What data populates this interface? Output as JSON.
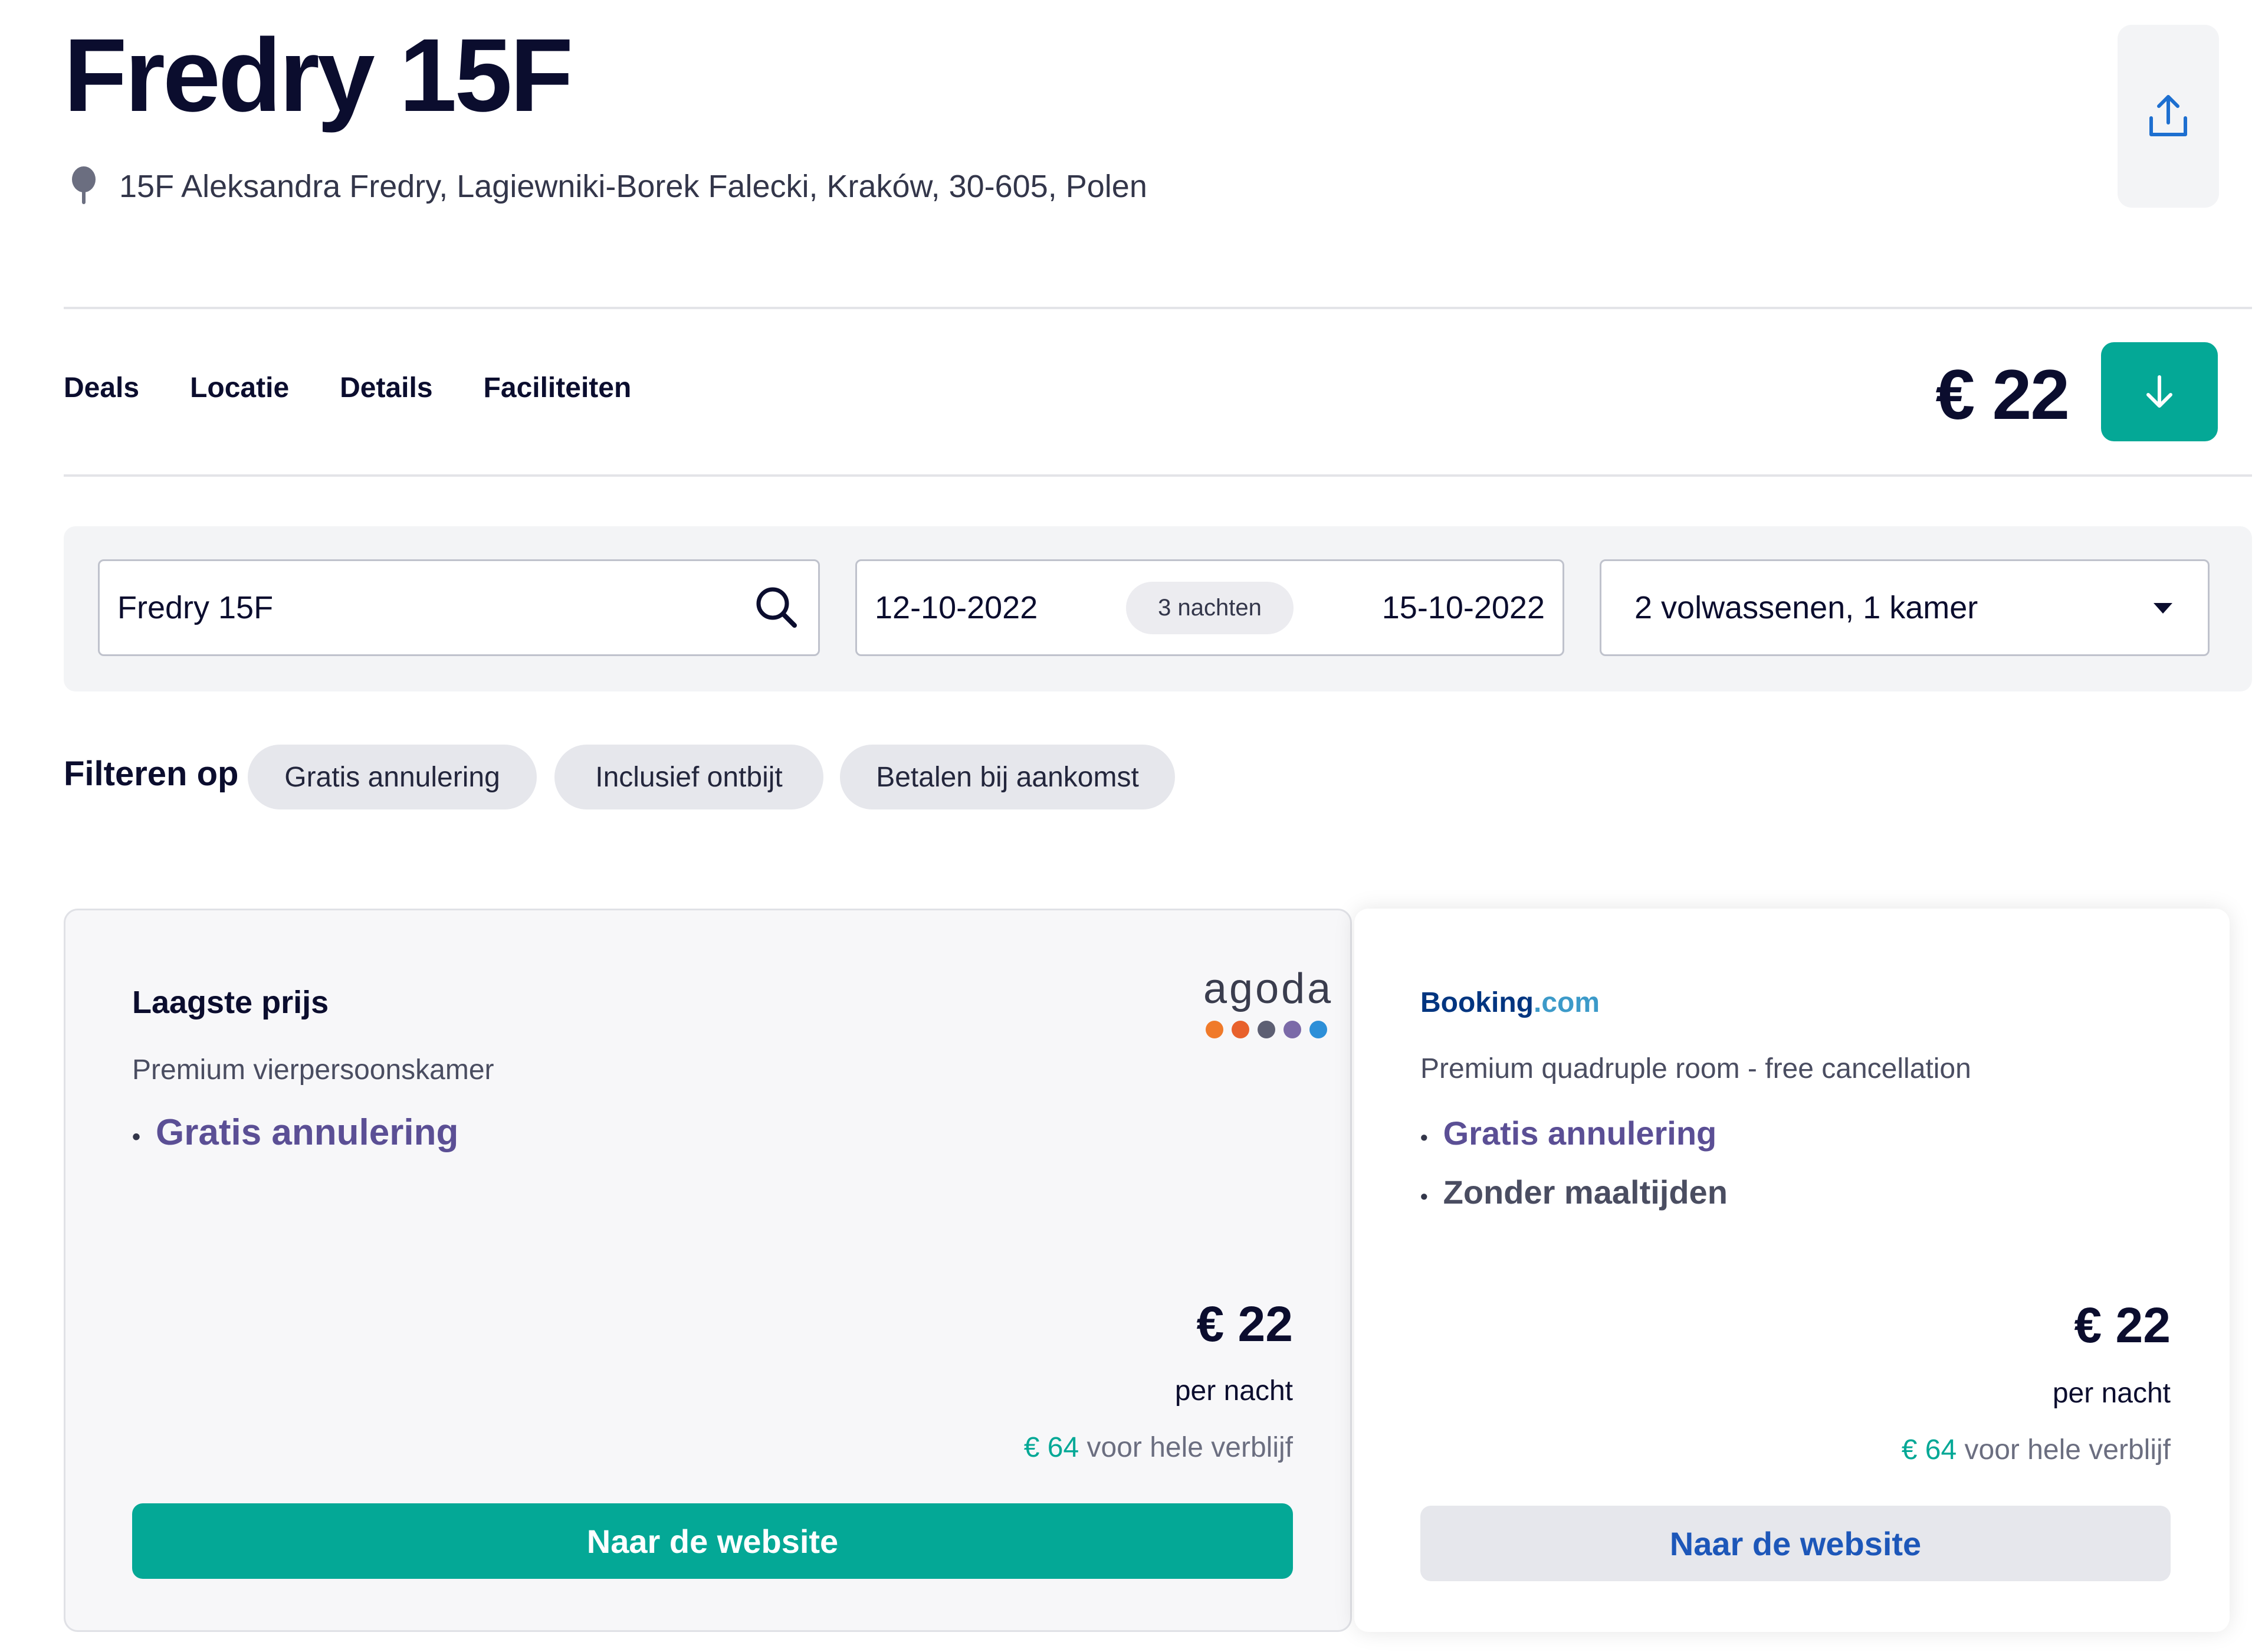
{
  "hotel": {
    "name": "Fredry 15F",
    "address": "15F Aleksandra Fredry, Lagiewniki-Borek Falecki, Kraków, 30-605, Polen"
  },
  "nav": {
    "tabs": [
      "Deals",
      "Locatie",
      "Details",
      "Faciliteiten"
    ],
    "price": "€ 22"
  },
  "search": {
    "destination": "Fredry 15F",
    "checkin": "12-10-2022",
    "nights": "3 nachten",
    "checkout": "15-10-2022",
    "guests": "2 volwassenen, 1 kamer"
  },
  "filters": {
    "label": "Filteren op",
    "chips": [
      "Gratis annulering",
      "Inclusief ontbijt",
      "Betalen bij aankomst"
    ]
  },
  "deals": [
    {
      "heading": "Laagste prijs",
      "provider_logo_text": "agoda",
      "room": "Premium vierpersoonskamer",
      "features": [
        "Gratis annulering"
      ],
      "price": "€ 22",
      "per_night": "per nacht",
      "total_amount": "€ 64",
      "total_suffix": "voor hele verblijf",
      "cta": "Naar de website"
    },
    {
      "provider_logo_text": "Booking",
      "provider_logo_suffix": ".com",
      "room": "Premium quadruple room - free cancellation",
      "features": [
        "Gratis annulering",
        "Zonder maaltijden"
      ],
      "price": "€ 22",
      "per_night": "per nacht",
      "total_amount": "€ 64",
      "total_suffix": "voor hele verblijf",
      "cta": "Naar de website"
    }
  ],
  "colors": {
    "accent_teal": "#04a896",
    "feature_purple": "#5b4f95",
    "booking_blue": "#1d57b9",
    "agoda_dots": [
      "#f07a2a",
      "#e8612c",
      "#5d5f73",
      "#7b6aa8",
      "#2d8fd8"
    ]
  },
  "icons": {
    "location": "map-pin-icon",
    "share": "share-upload-icon",
    "scroll_down": "arrow-down-icon",
    "search": "search-icon",
    "dropdown": "caret-down-icon"
  }
}
